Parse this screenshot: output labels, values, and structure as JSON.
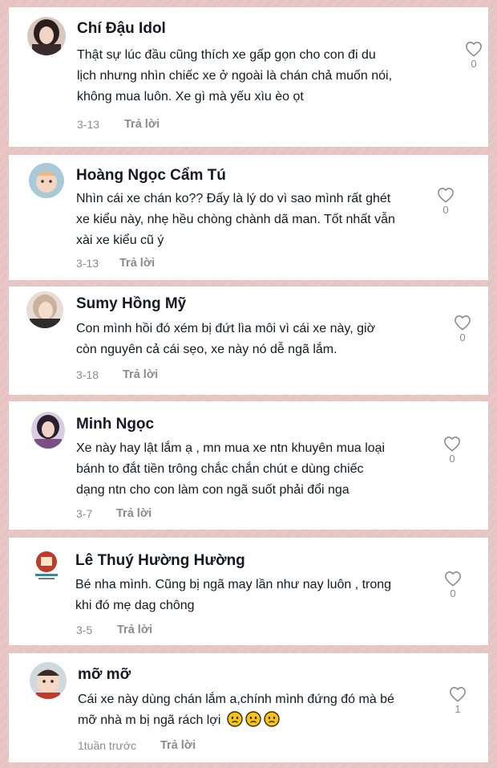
{
  "comments": [
    {
      "name": "Chí Đậu Idol",
      "lines": [
        "Thật sự lúc đầu cũng thích xe gấp gọn cho con đi du",
        "lịch nhưng nhìn chiếc xe ở ngoài là chán chả muốn nói,",
        "không mua luôn. Xe gì mà yếu xìu èo ọt"
      ],
      "date": "3-13",
      "reply": "Trả lời",
      "likes": "0",
      "avatar_icon": "avatar-woman-dark-hair"
    },
    {
      "name": "Hoàng Ngọc Cẩm Tú",
      "lines": [
        "Nhìn cái xe chán ko?? Đấy là lý do vì sao mình rất ghét",
        "xe kiểu này, nhẹ hều chòng chành dã man. Tốt nhất vẫn",
        "xài xe kiểu cũ ý"
      ],
      "date": "3-13",
      "reply": "Trả lời",
      "likes": "0",
      "avatar_icon": "avatar-baby"
    },
    {
      "name": "Sumy Hồng Mỹ",
      "lines": [
        "Con mình hồi đó xém bị đứt lìa môi vì cái xe này, giờ",
        "còn nguyên cả cái sẹo, xe này nó dễ ngã lắm."
      ],
      "date": "3-18",
      "reply": "Trả lời",
      "likes": "0",
      "avatar_icon": "avatar-woman-light-hair"
    },
    {
      "name": "Minh Ngọc",
      "lines": [
        "Xe này hay lật lắm ạ , mn mua xe ntn khuyên mua loại",
        "bánh to đắt tiền trông chắc chắn chút e dùng chiếc",
        "dạng ntn cho con làm con ngã suốt phải đổi nga"
      ],
      "date": "3-7",
      "reply": "Trả lời",
      "likes": "0",
      "avatar_icon": "avatar-woman-purple"
    },
    {
      "name": "Lê Thuý Hường Hường",
      "lines": [
        "Bé nha mình. Cũng bị ngã may lần như nay luôn , trong",
        "khi đó mẹ dag chông"
      ],
      "date": "3-5",
      "reply": "Trả lời",
      "likes": "0",
      "avatar_icon": "avatar-logo"
    },
    {
      "name": "mỡ mỡ",
      "lines": [
        "Cái xe này dùng chán lắm a,chính mình đứng đó mà bé",
        "mỡ nhà m bị ngã rách lợi"
      ],
      "date": "1tuần trước",
      "reply": "Trả lời",
      "likes": "1",
      "avatar_icon": "avatar-toddler",
      "emoji_icons": [
        "sad-face-emoji",
        "sad-face-emoji",
        "sad-face-emoji"
      ]
    }
  ],
  "colors": {
    "text": "#161823",
    "muted": "#8a8b91",
    "background": "#e7c3c1"
  }
}
